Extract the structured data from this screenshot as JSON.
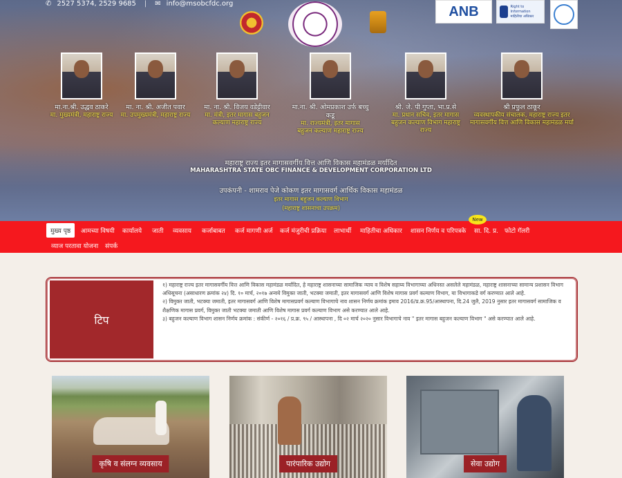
{
  "contact": {
    "phone": "2527 5374, 2529 9685",
    "separator": "|",
    "email": "info@msobcfdc.org"
  },
  "logos": {
    "anb": "ANB",
    "rti_line1": "Right to Information",
    "rti_line2": "माहितीचा अधिकार"
  },
  "leaders": [
    {
      "name": "मा.ना.श्री. उद्धव ठाकरे",
      "title": "मा. मुख्यमंत्री, महाराष्ट्र राज्य"
    },
    {
      "name": "मा. ना. श्री. अजीत पवार",
      "title": "मा. उपमुख्यमंत्री, महाराष्ट्र राज्य"
    },
    {
      "name": "मा. ना. श्री. विजय वडेट्टीवार",
      "title": "मा. मंत्री, इतर मागास बहुजन कल्याण महाराष्ट्र राज्य"
    },
    {
      "name": "मा.ना. श्री. ओमप्रकाश उर्फ बच्चु कडू",
      "title": "मा. राज्यमंत्री, इतर मागास बहुजन कल्याण महाराष्ट्र राज्य"
    },
    {
      "name": "श्री. जे. पी गुप्ता, भा.प्र.से",
      "title": "मा. प्रधान सचिव, इतर मागास बहुजन कल्याण विभाग महाराष्ट्र राज्य"
    },
    {
      "name": "श्री प्रफुल ठाकूर",
      "title": "व्यवस्थापकीय संचालक, महाराष्ट्र राज्य इतर मागासवर्गीय वित्त आणि विकास महामंडळ मर्या"
    }
  ],
  "corp": {
    "name_marathi": "महाराष्ट्र राज्य इतर मागासवर्गीय वित्त आणि विकास महामंडळ मर्यादित",
    "name_english": "MAHARASHTRA STATE OBC FINANCE & DEVELOPMENT CORPORATION LTD",
    "subsidiary": "उपकंपनी - शामराव पेजे कोकण इतर मागासवर्ग आर्थिक विकास महामंडळ",
    "department": "इतर मागास बहुजन कल्याण विभाग",
    "undertaking": "(महाराष्ट्र शासनाचा उपक्रम)"
  },
  "nav": {
    "items": [
      "मुख्य पृष्ठ",
      "आमच्या विषयी",
      "कार्यालये",
      "जाती",
      "व्यवसाय",
      "कर्जाबाबत",
      "कर्ज मागणी अर्ज",
      "कर्ज मंजुरीची प्रक्रिया",
      "लाभार्थी",
      "माहितीचा अधिकार",
      "शासन निर्णय व परिपत्रके",
      "सा. दि. प्र.",
      "फोटो गॅलरी",
      "व्याज परतावा योजना",
      "संपर्क"
    ],
    "new_badge": "New"
  },
  "tip": {
    "label": "टिप",
    "lines": [
      "१) महाराष्ट्र राज्य इतर मागासवर्गीय वित्त आणि विकास महामंडळ मर्यादित, हे महाराष्ट्र शासनाच्या सामाजिक न्याय व विशेष सहाय्य विभागाच्या अधिनस्त असलेले महामंडळ, महाराष्ट्र शासनाच्या सामान्य प्रशासन विभाग अधिसूचना (असाधारण क्रमांक २४) दि. १० मार्च, २०१७ अन्वये विमुक्त जाती, भटक्या जमाती, इतर मागासवर्ग आणि विशेष मागास प्रवर्ग कल्याण विभाग, या विभागाकडे वर्ग करण्यात आले आहे.",
      "२) विमुक्त जाती, भटक्या जमाती, इतर मागासवर्ग आणि विशेष मागासप्रवर्ग कल्याण विभागाचे नाव शासन निर्णय क्रमांक इमाव 2016/प्र.क्र.95/आस्थापना, दि.24 जुलै, 2019 नुसार इतर मागासवर्ग सामाजिक व शैक्षणिक मागास प्रवर्ग, विमुक्त जाती भटक्या जमाती आणि विशेष मागास प्रवर्ग कल्याण विभाग असे करण्यात आले आहे.",
      "३) बहुजन कल्याण विभाग शासन निर्णय क्रमांक : संकीर्ण - २०१६ / प्र.क्र. ९५ / आस्थापना , दि ०२ मार्च २०२० नुसार विभागाचे नाव \" इतर मागास बहुजन कल्याण विभाग \" असे करण्यात आले आहे."
    ]
  },
  "cards": [
    {
      "caption": "कृषि व संलग्न व्यवसाय"
    },
    {
      "caption": "पारंपारिक उद्योग"
    },
    {
      "caption": "सेवा उद्योग"
    }
  ],
  "colors": {
    "nav_red": "#f5181e",
    "tip_red": "#a2282b",
    "leader_title_yellow": "#f4e24a"
  },
  "icons": {
    "phone": "phone-icon",
    "email": "email-icon"
  }
}
